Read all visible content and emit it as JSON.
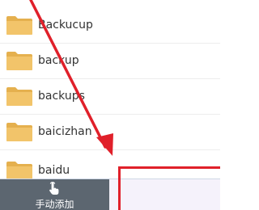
{
  "folders": [
    {
      "name": "Backucup",
      "icon": "folder-icon"
    },
    {
      "name": "backup",
      "icon": "folder-icon"
    },
    {
      "name": "backups",
      "icon": "folder-icon"
    },
    {
      "name": "baicizhan",
      "icon": "folder-icon"
    },
    {
      "name": "baidu",
      "icon": "folder-icon"
    }
  ],
  "bottom_bar": {
    "manual_add_label": "手动添加",
    "manual_add_icon": "hand-tap-icon"
  },
  "colors": {
    "folder": "#f2c46a",
    "folder_dark": "#e5b04e",
    "annotation": "#e0202a",
    "button_bg": "#5c6670"
  }
}
